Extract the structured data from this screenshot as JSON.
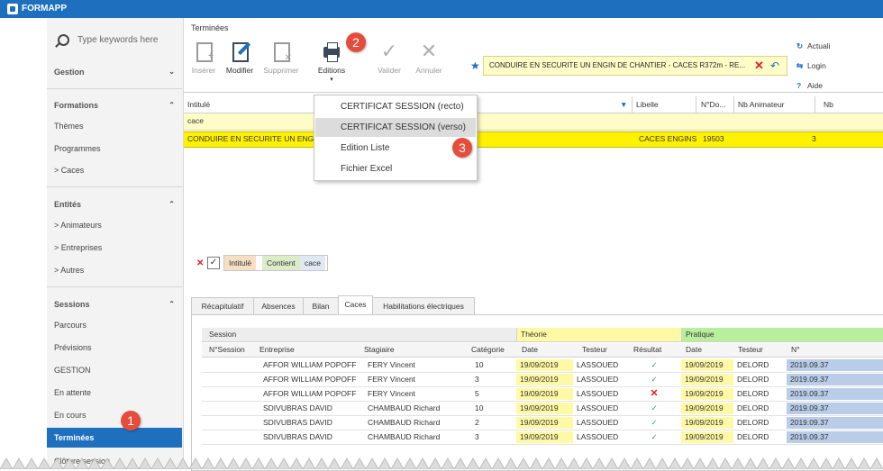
{
  "app": {
    "title": "FORMAPP"
  },
  "sidebar": {
    "search_placeholder": "Type keywords here",
    "sections": [
      {
        "label": "Gestion"
      },
      {
        "label": "Formations",
        "items": [
          "Thèmes",
          "Programmes",
          "> Caces"
        ]
      },
      {
        "label": "Entités",
        "items": [
          "> Animateurs",
          "> Entreprises",
          "> Autres"
        ]
      },
      {
        "label": "Sessions",
        "items": [
          "Parcours",
          "Prévisions",
          "GESTION",
          "En attente",
          "En cours",
          "Terminées",
          "Clôture session"
        ]
      }
    ]
  },
  "toolbar": {
    "title": "Terminées",
    "buttons": {
      "insert": "Insérer",
      "edit": "Modifier",
      "delete": "Supprimer",
      "editions": "Editions",
      "validate": "Valider",
      "cancel": "Annuler"
    },
    "filter_text": "CONDUIRE EN SECURITE UN ENGIN DE CHANTIER - CACES R372m - RE...",
    "right": {
      "refresh": "Actuali",
      "login": "Login",
      "help": "Aide"
    }
  },
  "grid": {
    "columns": {
      "intitule": "Intitulé",
      "libelle": "Libelle",
      "nodo": "N°Do...",
      "nb_anim": "Nb Animateur",
      "nb": "Nb"
    },
    "filter_value": "cace",
    "row": {
      "intitule": "CONDUIRE EN SECURITE UN ENGIN",
      "libelle": "CACES ENGINS",
      "nodo": "19503",
      "nb_anim": "3"
    }
  },
  "menu": {
    "items": [
      "CERTIFICAT SESSION (recto)",
      "CERTIFICAT SESSION (verso)",
      "Edition Liste",
      "Fichier Excel"
    ],
    "highlighted_index": 1
  },
  "filter_chip": {
    "field": "Intitulé",
    "op": "Contient",
    "value": "cace"
  },
  "tabs": [
    "Récapitulatif",
    "Absences",
    "Bilan",
    "Caces",
    "Habilitations électriques"
  ],
  "active_tab": "Caces",
  "caces_table": {
    "group_session": "Session",
    "group_theorie": "Théorie",
    "group_pratique": "Pratique",
    "headers": [
      "N°Session",
      "Entreprise",
      "Stagiaire",
      "Catégorie",
      "Date",
      "Testeur",
      "Résultat",
      "Date",
      "Testeur",
      "N°"
    ],
    "rows": [
      [
        "",
        "AFFOR WILLIAM POPOFF",
        "FERY Vincent",
        "10",
        "19/09/2019",
        "LASSOUED",
        "ok",
        "19/09/2019",
        "DELORD",
        "2019.09.37"
      ],
      [
        "",
        "AFFOR WILLIAM POPOFF",
        "FERY Vincent",
        "3",
        "19/09/2019",
        "LASSOUED",
        "ok",
        "19/09/2019",
        "DELORD",
        "2019.09.37"
      ],
      [
        "",
        "AFFOR WILLIAM POPOFF",
        "FERY Vincent",
        "5",
        "19/09/2019",
        "LASSOUED",
        "ko",
        "19/09/2019",
        "DELORD",
        "2019.09.37"
      ],
      [
        "",
        "SDIVUBRAS DAVID",
        "CHAMBAUD Richard",
        "10",
        "19/09/2019",
        "LASSOUED",
        "ok",
        "19/09/2019",
        "DELORD",
        "2019.09.37"
      ],
      [
        "",
        "SDIVUBRAS DAVID",
        "CHAMBAUD Richard",
        "2",
        "19/09/2019",
        "LASSOUED",
        "ok",
        "19/09/2019",
        "DELORD",
        "2019.09.37"
      ],
      [
        "",
        "SDIVUBRAS DAVID",
        "CHAMBAUD Richard",
        "3",
        "19/09/2019",
        "LASSOUED",
        "ok",
        "19/09/2019",
        "DELORD",
        "2019.09.37"
      ]
    ]
  },
  "badges": [
    "1",
    "2",
    "3"
  ],
  "colors": {
    "accent": "#1e70bf",
    "badge": "#e64c3c",
    "selected_row": "#fff200",
    "theorie": "#fff9a6",
    "pratique": "#b8ef9c"
  }
}
